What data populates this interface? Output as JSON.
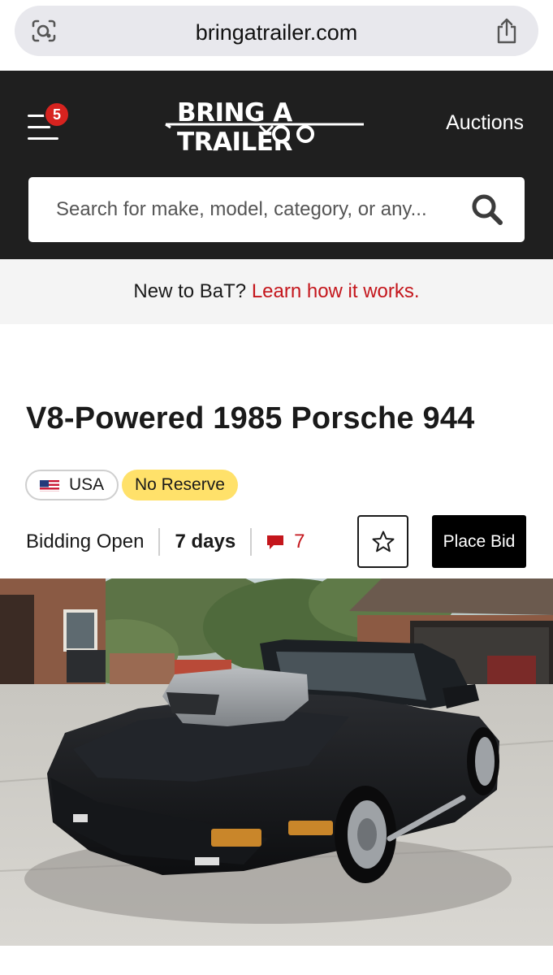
{
  "browser": {
    "url": "bringatrailer.com",
    "icons": {
      "lens": "visual-lookup-icon",
      "share": "share-icon"
    }
  },
  "header": {
    "menu_badge": "5",
    "logo_text": "BRING A TRAILER",
    "auctions_label": "Auctions",
    "search_placeholder": "Search for make, model, category, or any...",
    "colors": {
      "background": "#1f1f1f",
      "badge": "#d7231f"
    }
  },
  "promo": {
    "text": "New to BaT?",
    "link_text": "Learn how it works.",
    "link_color": "#c4161c"
  },
  "listing": {
    "title": "V8-Powered 1985 Porsche 944",
    "country": "USA",
    "reserve": "No Reserve",
    "status": "Bidding Open",
    "time_left": "7 days",
    "comment_count": "7",
    "place_bid_label": "Place Bid",
    "watch_icon": "star-icon",
    "comment_icon": "comment-icon"
  }
}
